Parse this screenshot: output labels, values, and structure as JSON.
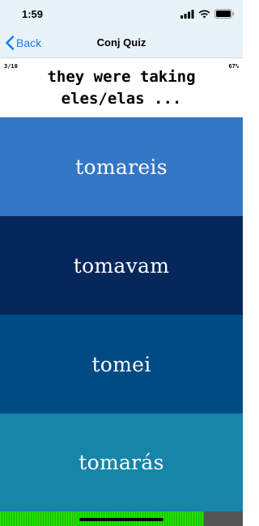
{
  "status_bar": {
    "time": "1:59",
    "icons": [
      "signal-icon",
      "wifi-icon",
      "battery-icon"
    ]
  },
  "nav": {
    "back_label": "Back",
    "title": "Conj Quiz"
  },
  "quiz": {
    "counter": "3/10",
    "percent": "67%",
    "question_line1": "they were taking",
    "question_line2": "eles/elas ..."
  },
  "answers": [
    {
      "label": "tomareis",
      "color": "#3377c6"
    },
    {
      "label": "tomavam",
      "color": "#062759"
    },
    {
      "label": "tomei",
      "color": "#004b84"
    },
    {
      "label": "tomarás",
      "color": "#1685a7"
    }
  ],
  "progress": {
    "fraction": 0.84,
    "fill_color": "#22e000",
    "track_color": "#555555"
  },
  "colors": {
    "accent": "#1a7cf5",
    "nav_background": "#e8f3f8"
  }
}
